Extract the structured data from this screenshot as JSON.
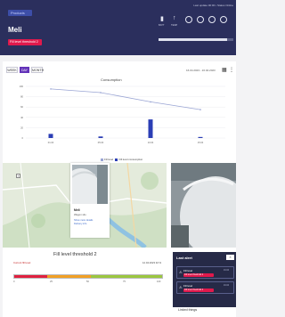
{
  "header": {
    "back_label": "Products",
    "title": "Meli",
    "alert_badge": "Fill level threshold 2",
    "meta": "Last update 00:00 • Status Online",
    "icons": [
      {
        "name": "battery-icon",
        "label": "BATT"
      },
      {
        "name": "temperature-icon",
        "label": "TEMP"
      },
      {
        "name": "signal-icon",
        "label": ""
      },
      {
        "name": "gps-icon",
        "label": ""
      },
      {
        "name": "status-icon",
        "label": ""
      },
      {
        "name": "settings-icon",
        "label": ""
      }
    ],
    "status_bar_fill": 0.92
  },
  "tabs": [
    "WEEK",
    "DAY",
    "MONTH"
  ],
  "active_tab": 1,
  "date_range": "16.04.2023 - 16.04.2023",
  "chart_data": {
    "type": "bar",
    "title": "Consumption",
    "categories": [
      "01.04",
      "05.04",
      "10.04",
      "15.04"
    ],
    "series": [
      {
        "name": "Fill level",
        "type": "line",
        "values": [
          95,
          88,
          70,
          55
        ]
      },
      {
        "name": "Fill level consumption",
        "type": "bar",
        "values": [
          8,
          3,
          36,
          2
        ]
      }
    ],
    "ylim": [
      0,
      100
    ],
    "grid": true,
    "legend_position": "bottom",
    "colors": {
      "line": "#9aa5d4",
      "bar": "#2b3eb5"
    }
  },
  "map": {
    "zoom_in_label": "+",
    "popup": {
      "name": "Meli",
      "subtitle": "Wagon silo",
      "link1": "Show more details",
      "link2": "Delivery info"
    }
  },
  "fill_level": {
    "title": "Fill level threshold 2",
    "left_label": "Current fill level",
    "right_label": "12.04.2023 32 %",
    "level": 0.22,
    "ticks": [
      "0",
      "25",
      "50",
      "75",
      "100"
    ],
    "colors": {
      "danger": "#e0203f",
      "warning": "#f2a024",
      "ok": "#9bc73f"
    }
  },
  "alerts": {
    "title": "Last alert",
    "close_label": "×",
    "items": [
      {
        "title": "Fill level",
        "badge": "Fill level threshold 2",
        "date": "16.04"
      },
      {
        "title": "Fill level",
        "badge": "Fill level threshold 2",
        "date": "16.04"
      }
    ]
  },
  "linked_things_title": "Linked things"
}
